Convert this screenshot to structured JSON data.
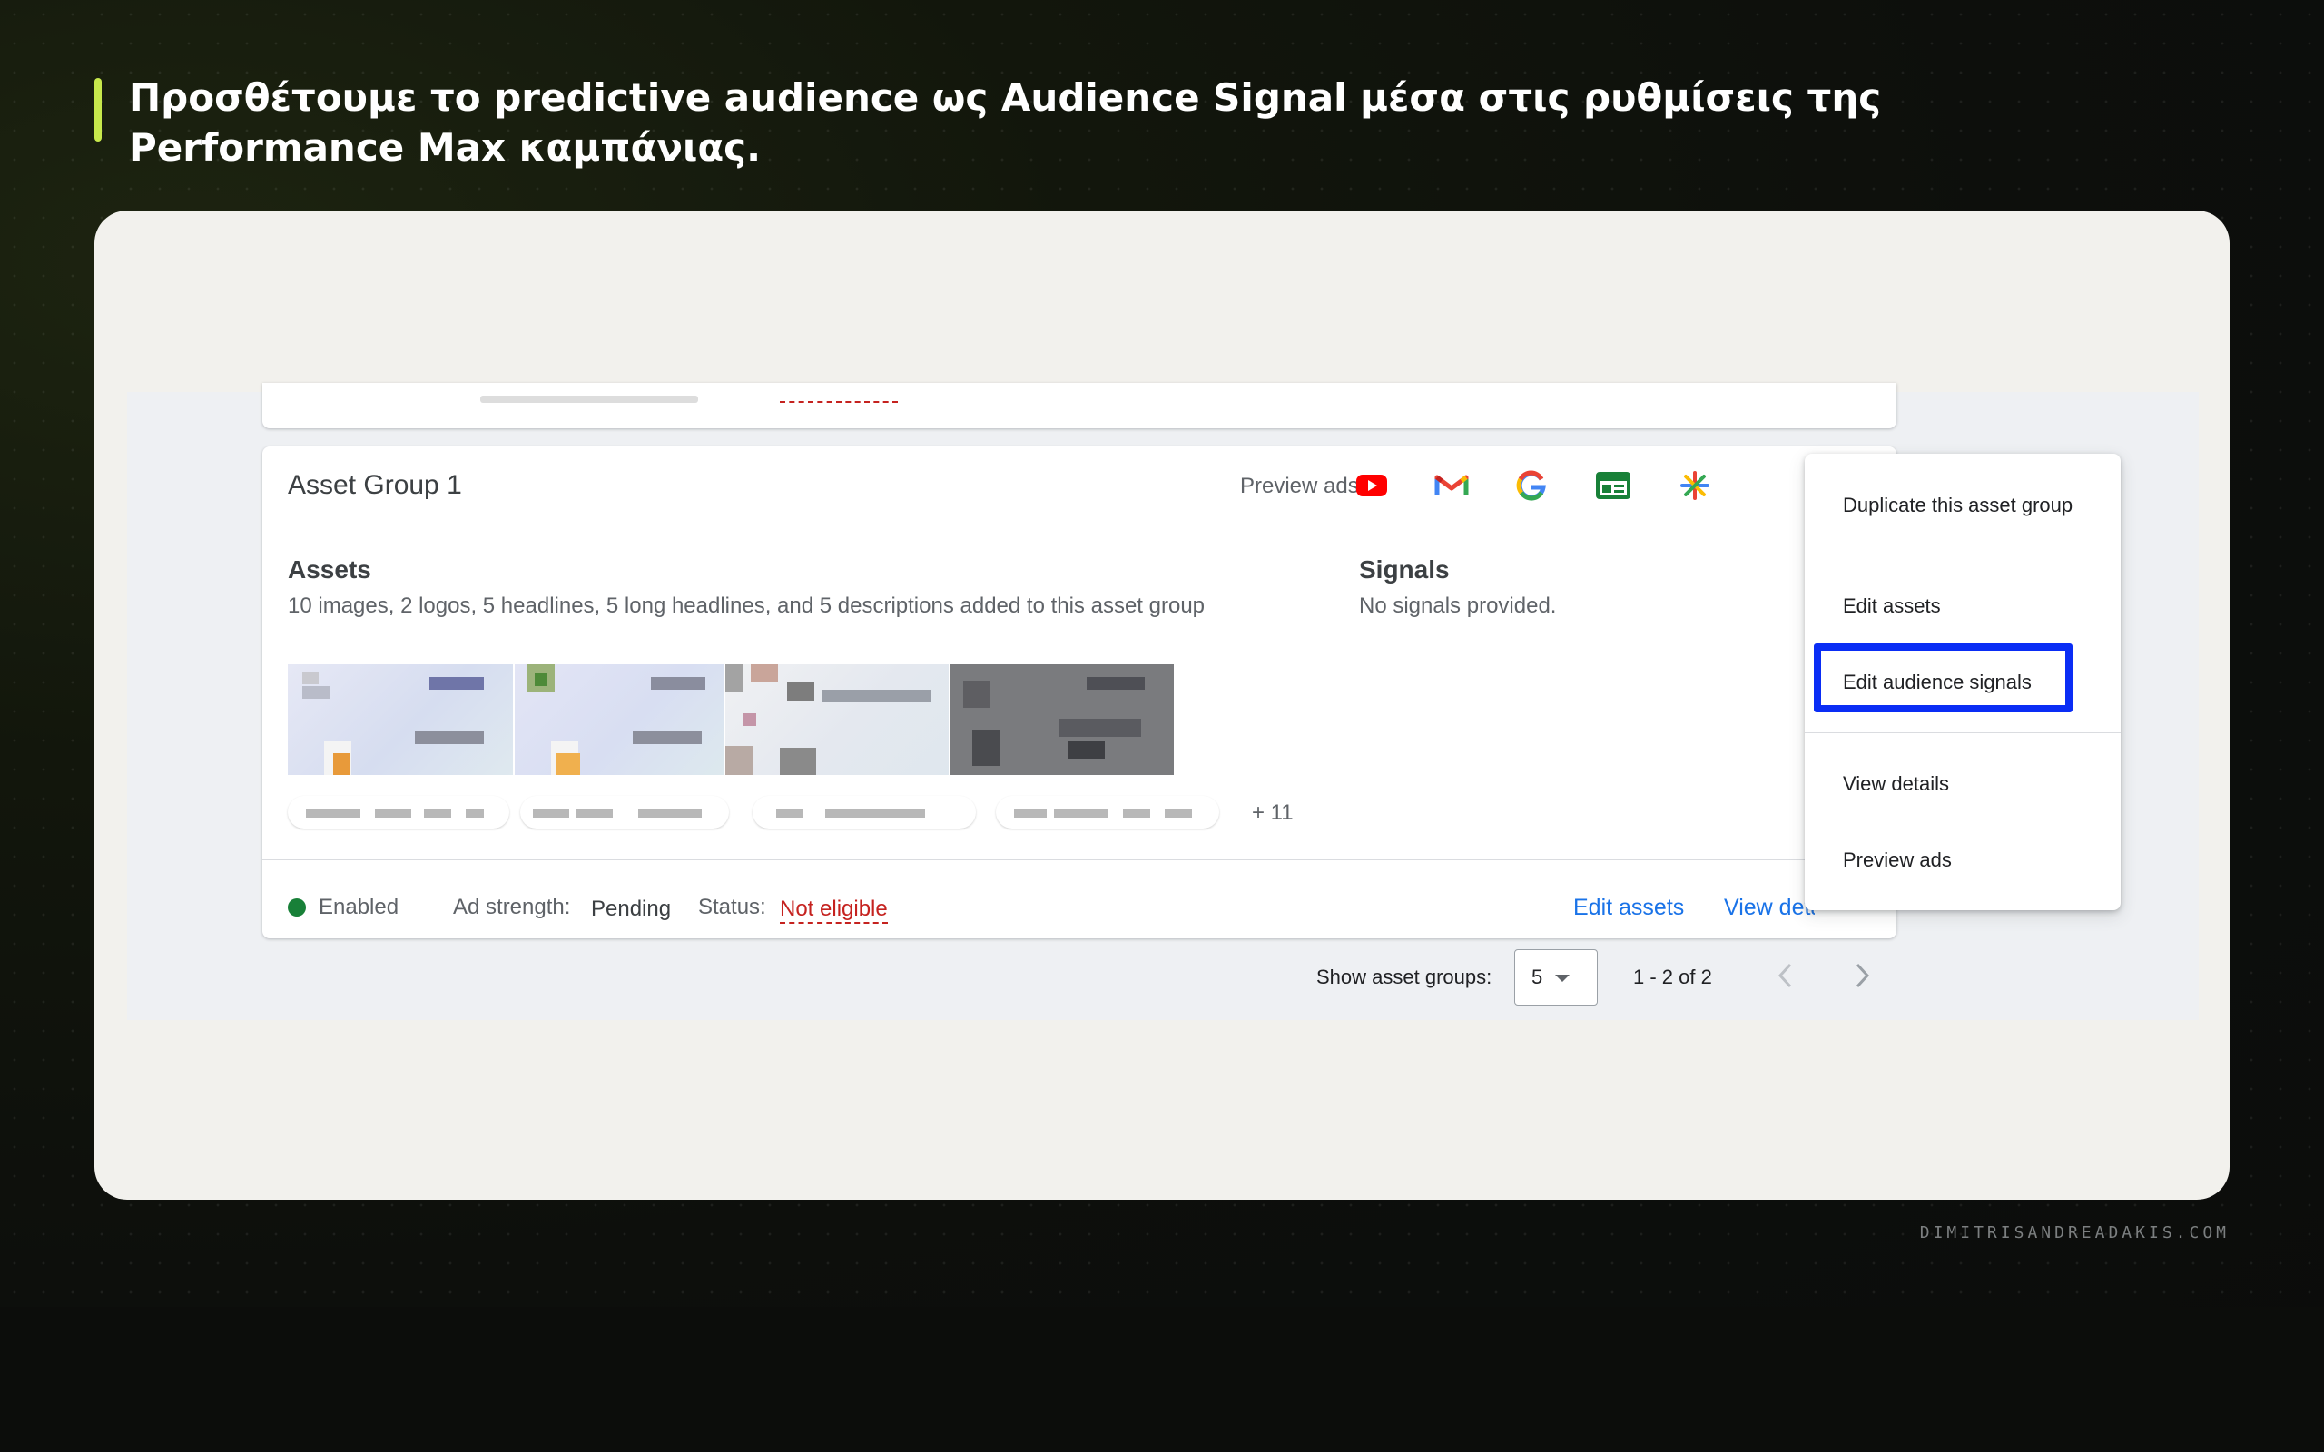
{
  "slide": {
    "title": "Προσθέτουμε το predictive audience ως Audience Signal μέσα στις ρυθμίσεις της Performance Max καμπάνιας.",
    "watermark": "DIMITRISANDREADAKIS.COM",
    "accent_color": "#c7e84c"
  },
  "asset_group": {
    "title": "Asset Group 1",
    "preview_label": "Preview ads",
    "preview_icons": [
      "youtube-icon",
      "gmail-icon",
      "google-icon",
      "display-icon",
      "discover-icon"
    ],
    "assets_title": "Assets",
    "assets_desc": "10 images, 2 logos, 5 headlines, 5 long headlines, and 5 descriptions added to this asset group",
    "more_count": "+ 11",
    "signals_title": "Signals",
    "signals_desc": "No signals provided.",
    "status_enabled": "Enabled",
    "ad_strength_label": "Ad strength:",
    "ad_strength_value": "Pending",
    "status_label": "Status:",
    "status_value": "Not eligible",
    "edit_assets": "Edit assets",
    "view_details": "View details"
  },
  "pagination": {
    "show_label": "Show asset groups:",
    "page_size": "5",
    "range": "1 - 2 of 2"
  },
  "menu": {
    "items": [
      "Duplicate this asset group",
      "Edit assets",
      "Edit audience signals",
      "View details",
      "Preview ads"
    ],
    "highlighted": "Edit audience signals",
    "highlight_color": "#0a2df5"
  },
  "colors": {
    "link": "#1a73e8",
    "error": "#c5221f",
    "enabled": "#188038"
  }
}
